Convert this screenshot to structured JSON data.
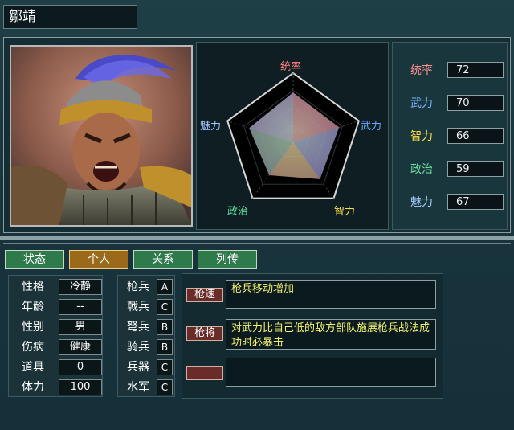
{
  "officer": {
    "name": "鄒靖"
  },
  "colors": {
    "leadership": "#ff8080",
    "war": "#6aa8ff",
    "intelligence": "#ffe040",
    "politics": "#5fe09a",
    "charisma": "#9ec8ff"
  },
  "radar": {
    "labels": {
      "leadership": "统率",
      "war": "武力",
      "intelligence": "智力",
      "politics": "政治",
      "charisma": "魅力"
    }
  },
  "stats": [
    {
      "label": "统率",
      "value": "72",
      "color": "#ff9090"
    },
    {
      "label": "武力",
      "value": "70",
      "color": "#7ab0ff"
    },
    {
      "label": "智力",
      "value": "66",
      "color": "#ffe040"
    },
    {
      "label": "政治",
      "value": "59",
      "color": "#6ee0a0"
    },
    {
      "label": "魅力",
      "value": "67",
      "color": "#a8d0ff"
    }
  ],
  "tabs": [
    {
      "label": "状态"
    },
    {
      "label": "个人"
    },
    {
      "label": "关系"
    },
    {
      "label": "列传"
    }
  ],
  "info": [
    {
      "label": "性格",
      "value": "冷静"
    },
    {
      "label": "年龄",
      "value": "--"
    },
    {
      "label": "性别",
      "value": "男"
    },
    {
      "label": "伤病",
      "value": "健康"
    },
    {
      "label": "道具",
      "value": "0"
    },
    {
      "label": "体力",
      "value": "100"
    }
  ],
  "arms": [
    {
      "label": "枪兵",
      "value": "A"
    },
    {
      "label": "戟兵",
      "value": "C"
    },
    {
      "label": "弩兵",
      "value": "B"
    },
    {
      "label": "骑兵",
      "value": "B"
    },
    {
      "label": "兵器",
      "value": "C"
    },
    {
      "label": "水军",
      "value": "C"
    }
  ],
  "skills": [
    {
      "tag": "枪速",
      "desc": "枪兵移动增加"
    },
    {
      "tag": "枪将",
      "desc": "对武力比自己低的敌方部队施展枪兵战法成功时必暴击"
    },
    {
      "tag": "",
      "desc": ""
    }
  ]
}
